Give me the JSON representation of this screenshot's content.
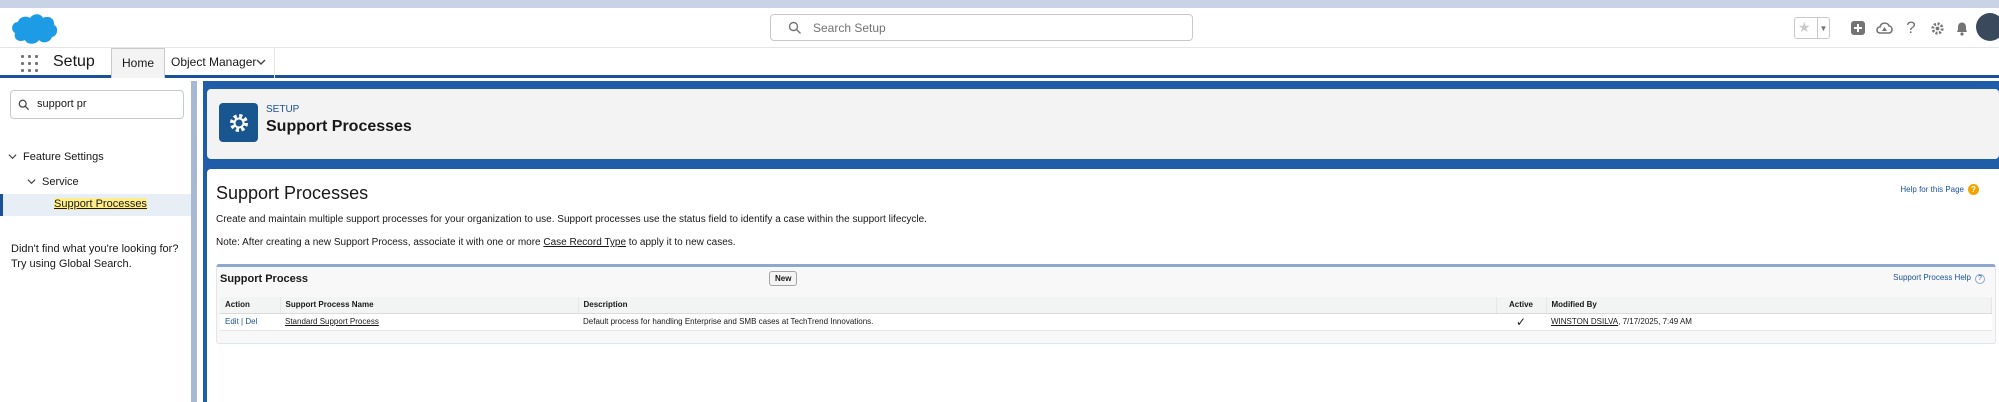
{
  "header": {
    "search_placeholder": "Search Setup"
  },
  "nav": {
    "app_name": "Setup",
    "tabs": [
      "Home",
      "Object Manager"
    ]
  },
  "sidebar": {
    "quick_find_value": "support pr",
    "tree": {
      "section": "Feature Settings",
      "group": "Service",
      "item": "Support Processes"
    },
    "not_found_line1": "Didn't find what you're looking for?",
    "not_found_line2": "Try using Global Search."
  },
  "banner": {
    "eyebrow": "SETUP",
    "title": "Support Processes"
  },
  "main": {
    "title": "Support Processes",
    "help_link": "Help for this Page",
    "description": "Create and maintain multiple support processes for your organization to use. Support processes use the status field to identify a case within the support lifecycle.",
    "note_prefix": "Note: After creating a new Support Process, associate it with one or more ",
    "note_link": "Case Record Type",
    "note_suffix": " to apply it to new cases."
  },
  "related_list": {
    "title": "Support Process",
    "new_button": "New",
    "help_link": "Support Process Help",
    "columns": [
      "Action",
      "Support Process Name",
      "Description",
      "Active",
      "Modified By"
    ],
    "rows": [
      {
        "edit": "Edit",
        "separator": " | ",
        "del": "Del",
        "name": "Standard Support Process",
        "description": "Default process for handling Enterprise and SMB cases at TechTrend Innovations.",
        "active": "✓",
        "modified_by": "WINSTON DSILVA",
        "modified_date": ", 7/17/2025, 7:49 AM"
      }
    ]
  },
  "colors": {
    "brand_blue": "#1f5da8",
    "link_blue": "#1b5297",
    "cloud_blue": "#1e9be5",
    "help_orange": "#f0a500"
  }
}
